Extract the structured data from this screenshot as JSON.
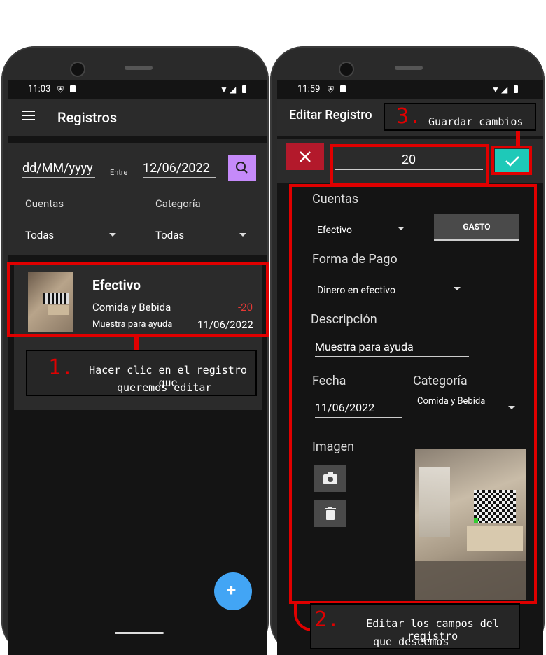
{
  "left": {
    "status_time": "11:03",
    "title": "Registros",
    "date_from_placeholder": "dd/MM/yyyy",
    "between_label": "Entre",
    "date_to": "12/06/2022",
    "accounts_label": "Cuentas",
    "category_label": "Categoría",
    "accounts_value": "Todas",
    "category_value": "Todas",
    "record": {
      "account": "Efectivo",
      "category": "Comida y Bebida",
      "amount": "-20",
      "description": "Muestra para ayuda",
      "date": "11/06/2022"
    },
    "fab_label": "+"
  },
  "right": {
    "status_time": "11:59",
    "title": "Editar Registro",
    "amount": "20",
    "accounts_label": "Cuentas",
    "account_value": "Efectivo",
    "type_button": "GASTO",
    "payment_label": "Forma de Pago",
    "payment_value": "Dinero en efectivo",
    "description_label": "Descripción",
    "description_value": "Muestra para ayuda",
    "date_label": "Fecha",
    "date_value": "11/06/2022",
    "category_label": "Categoría",
    "category_value": "Comida y Bebida",
    "image_label": "Imagen"
  },
  "callouts": {
    "c1_num": "1.",
    "c1_text_line1": "Hacer clic en el registro que",
    "c1_text_line2": "queremos editar",
    "c2_num": "2.",
    "c2_text_line1": "Editar los campos del registro",
    "c2_text_line2": "que deseemos",
    "c3_num": "3.",
    "c3_text": "Guardar cambios"
  },
  "colors": {
    "accent_purple": "#c58af9",
    "fab_blue": "#42a5f5",
    "confirm_teal": "#1ec9b8",
    "cancel_red": "#b3192b",
    "negative_red": "#e53935",
    "annotation_red": "#e00000"
  },
  "icons": [
    "menu-icon",
    "search-icon",
    "dropdown-arrow-icon",
    "plus-icon",
    "close-icon",
    "check-icon",
    "camera-icon",
    "trash-icon",
    "wifi-icon",
    "signal-icon",
    "battery-icon",
    "shield-icon",
    "sim-icon"
  ]
}
